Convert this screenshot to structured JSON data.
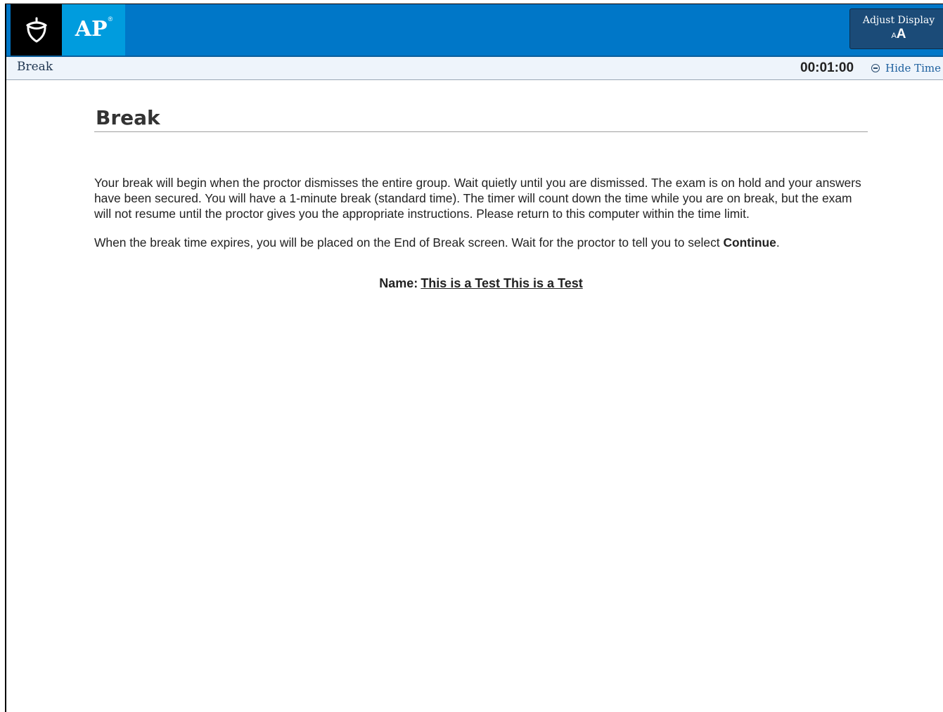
{
  "header": {
    "brand_logo_icon": "acorn-icon",
    "ap_label": "AP",
    "ap_registered": "®",
    "adjust_display": {
      "label": "Adjust Display",
      "icon_small": "A",
      "icon_big": "A"
    },
    "colors": {
      "topbar": "#0077c8",
      "ap_block": "#009cde",
      "logo_block": "#000000",
      "adjust_button": "#1b4b78"
    }
  },
  "subheader": {
    "section_name": "Break",
    "timer": "00:01:00",
    "hide_time_label": "Hide Time",
    "hide_time_icon": "minus-circle-icon"
  },
  "main": {
    "title": "Break",
    "paragraph1": "Your break will begin when the proctor dismisses the entire group. Wait quietly until you are dismissed. The exam is on hold and your answers have been secured. You will have a 1-minute break (standard time). The timer will count down the time while you are on break, but the exam will not resume until the proctor gives you the appropriate instructions. Please return to this computer within the time limit.",
    "paragraph2_prefix": "When the break time expires, you will be placed on the End of Break screen. Wait for the proctor to tell you to select ",
    "paragraph2_bold": "Continue",
    "paragraph2_suffix": ".",
    "name_label": "Name:",
    "name_value": "This is a Test This is a Test"
  }
}
